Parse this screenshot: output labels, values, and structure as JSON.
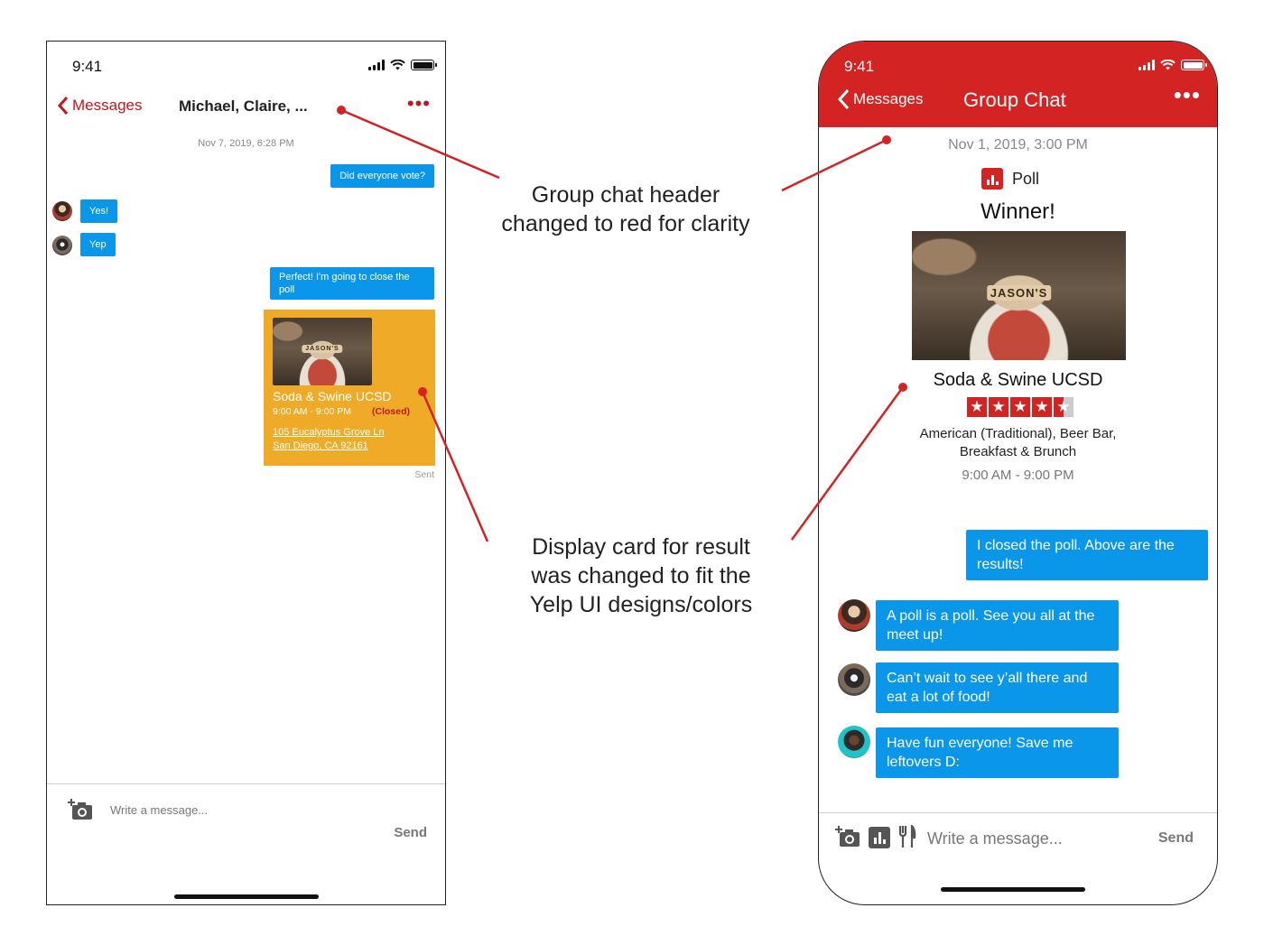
{
  "left_phone": {
    "status_time": "9:41",
    "back_label": "Messages",
    "header_title": "Michael, Claire, ...",
    "more_label": "•••",
    "date": "Nov 7, 2019, 6:28 PM",
    "messages": {
      "m1": "Did everyone vote?",
      "m2": "Yes!",
      "m3": "Yep",
      "m4": "Perfect! I'm going to close the poll"
    },
    "card": {
      "sign": "JASON'S",
      "name": "Soda & Swine UCSD",
      "hours": "9:00 AM - 9:00 PM",
      "status": "(Closed)",
      "address_line1": "105 Eucalyptus Grove Ln",
      "address_line2": "San Diego, CA 92161"
    },
    "sent_label": "Sent",
    "composer_placeholder": "Write a message...",
    "send_label": "Send"
  },
  "right_phone": {
    "status_time": "9:41",
    "back_label": "Messages",
    "header_title": "Group Chat",
    "more_label": "•••",
    "date": "Nov 1, 2019, 3:00 PM",
    "poll_label": "Poll",
    "winner_label": "Winner!",
    "card": {
      "sign": "JASON'S",
      "name": "Soda & Swine UCSD",
      "rating": 4.5,
      "categories_line1": "American (Traditional), Beer Bar,",
      "categories_line2": "Breakfast & Brunch",
      "hours": "9:00 AM - 9:00 PM"
    },
    "messages": {
      "m1": "I closed the poll. Above are the results!",
      "m2": "A poll is a poll. See you all at the meet up!",
      "m3": "Can’t wait to see y’all there and eat a lot of food!",
      "m4": "Have fun everyone! Save me leftovers D:"
    },
    "composer_placeholder": "Write a message...",
    "send_label": "Send"
  },
  "annotations": {
    "a1_line1": "Group chat header",
    "a1_line2": "changed to red for clarity",
    "a2_line1": "Display card for result",
    "a2_line2": "was changed to fit the",
    "a2_line3": "Yelp UI designs/colors"
  },
  "colors": {
    "yelp_red": "#d32323",
    "bubble_blue": "#0a97e9",
    "card_gold": "#efab28"
  }
}
